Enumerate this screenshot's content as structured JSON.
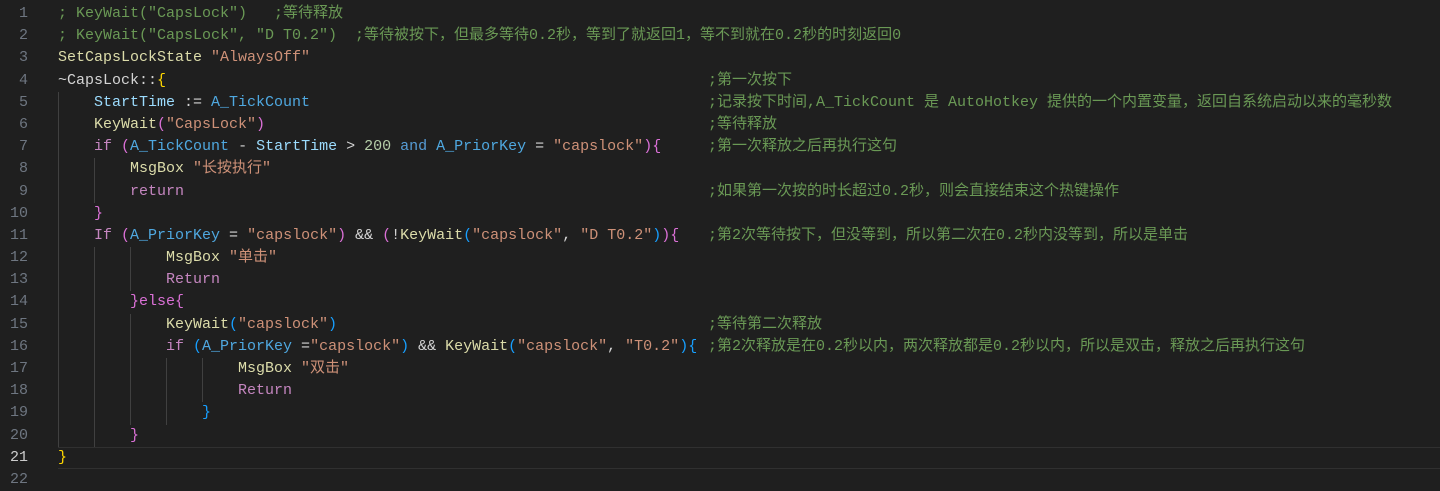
{
  "editor": {
    "active_line": 21,
    "lines": [
      {
        "n": "1",
        "indent": 0,
        "tokens": [
          {
            "t": "; KeyWait(\"CapsLock\")   ;等待释放",
            "c": "comment"
          }
        ]
      },
      {
        "n": "2",
        "indent": 0,
        "tokens": [
          {
            "t": "; KeyWait(\"CapsLock\", \"D T0.2\")  ;等待被按下，但最多等待0.2秒，等到了就返回1，等不到就在0.2秒的时刻返回0",
            "c": "comment"
          }
        ]
      },
      {
        "n": "3",
        "indent": 0,
        "tokens": [
          {
            "t": "SetCapsLockState ",
            "c": "func"
          },
          {
            "t": "\"AlwaysOff\"",
            "c": "string"
          }
        ]
      },
      {
        "n": "4",
        "indent": 0,
        "tokens": [
          {
            "t": "~CapsLock::",
            "c": "plain"
          },
          {
            "t": "{",
            "c": "b1"
          }
        ],
        "comment": ";第一次按下"
      },
      {
        "n": "5",
        "indent": 4,
        "tokens": [
          {
            "t": "StartTime",
            "c": "var"
          },
          {
            "t": " := ",
            "c": "plain"
          },
          {
            "t": "A_TickCount",
            "c": "builtin"
          }
        ],
        "comment": ";记录按下时间,A_TickCount 是 AutoHotkey 提供的一个内置变量，返回自系统启动以来的毫秒数"
      },
      {
        "n": "6",
        "indent": 4,
        "tokens": [
          {
            "t": "KeyWait",
            "c": "func"
          },
          {
            "t": "(",
            "c": "b2"
          },
          {
            "t": "\"CapsLock\"",
            "c": "string"
          },
          {
            "t": ")",
            "c": "b2"
          }
        ],
        "comment": ";等待释放"
      },
      {
        "n": "7",
        "indent": 4,
        "tokens": [
          {
            "t": "if ",
            "c": "ctrl"
          },
          {
            "t": "(",
            "c": "b2"
          },
          {
            "t": "A_TickCount",
            "c": "builtin"
          },
          {
            "t": " - ",
            "c": "plain"
          },
          {
            "t": "StartTime",
            "c": "var"
          },
          {
            "t": " > ",
            "c": "plain"
          },
          {
            "t": "200",
            "c": "num"
          },
          {
            "t": " and ",
            "c": "kw"
          },
          {
            "t": "A_PriorKey",
            "c": "builtin"
          },
          {
            "t": " = ",
            "c": "plain"
          },
          {
            "t": "\"capslock\"",
            "c": "string"
          },
          {
            "t": "){",
            "c": "b2"
          }
        ],
        "comment": ";第一次释放之后再执行这句"
      },
      {
        "n": "8",
        "indent": 8,
        "tokens": [
          {
            "t": "MsgBox ",
            "c": "func"
          },
          {
            "t": "\"长按执行\"",
            "c": "string"
          }
        ]
      },
      {
        "n": "9",
        "indent": 8,
        "tokens": [
          {
            "t": "return",
            "c": "ctrl"
          }
        ],
        "comment": ";如果第一次按的时长超过0.2秒，则会直接结束这个热键操作"
      },
      {
        "n": "10",
        "indent": 4,
        "tokens": [
          {
            "t": "}",
            "c": "b2"
          }
        ]
      },
      {
        "n": "11",
        "indent": 4,
        "tokens": [
          {
            "t": "If ",
            "c": "ctrl"
          },
          {
            "t": "(",
            "c": "b2"
          },
          {
            "t": "A_PriorKey",
            "c": "builtin"
          },
          {
            "t": " = ",
            "c": "plain"
          },
          {
            "t": "\"capslock\"",
            "c": "string"
          },
          {
            "t": ")",
            "c": "b2"
          },
          {
            "t": " && ",
            "c": "plain"
          },
          {
            "t": "(",
            "c": "b2"
          },
          {
            "t": "!",
            "c": "plain"
          },
          {
            "t": "KeyWait",
            "c": "func"
          },
          {
            "t": "(",
            "c": "b3"
          },
          {
            "t": "\"capslock\"",
            "c": "string"
          },
          {
            "t": ", ",
            "c": "plain"
          },
          {
            "t": "\"D T0.2\"",
            "c": "string"
          },
          {
            "t": ")",
            "c": "b3"
          },
          {
            "t": ")",
            "c": "b2"
          },
          {
            "t": "{",
            "c": "b2"
          }
        ],
        "comment": ";第2次等待按下，但没等到，所以第二次在0.2秒内没等到，所以是单击"
      },
      {
        "n": "12",
        "indent": 12,
        "tokens": [
          {
            "t": "MsgBox ",
            "c": "func"
          },
          {
            "t": "\"单击\"",
            "c": "string"
          }
        ]
      },
      {
        "n": "13",
        "indent": 12,
        "tokens": [
          {
            "t": "Return",
            "c": "ctrl"
          }
        ]
      },
      {
        "n": "14",
        "indent": 8,
        "tokens": [
          {
            "t": "}else{",
            "c": "b2"
          }
        ]
      },
      {
        "n": "15",
        "indent": 12,
        "tokens": [
          {
            "t": "KeyWait",
            "c": "func"
          },
          {
            "t": "(",
            "c": "b3"
          },
          {
            "t": "\"capslock\"",
            "c": "string"
          },
          {
            "t": ")",
            "c": "b3"
          }
        ],
        "comment": ";等待第二次释放"
      },
      {
        "n": "16",
        "indent": 12,
        "tokens": [
          {
            "t": "if ",
            "c": "ctrl"
          },
          {
            "t": "(",
            "c": "b3"
          },
          {
            "t": "A_PriorKey",
            "c": "builtin"
          },
          {
            "t": " =",
            "c": "plain"
          },
          {
            "t": "\"capslock\"",
            "c": "string"
          },
          {
            "t": ")",
            "c": "b3"
          },
          {
            "t": " && ",
            "c": "plain"
          },
          {
            "t": "KeyWait",
            "c": "func"
          },
          {
            "t": "(",
            "c": "b3"
          },
          {
            "t": "\"capslock\"",
            "c": "string"
          },
          {
            "t": ", ",
            "c": "plain"
          },
          {
            "t": "\"T0.2\"",
            "c": "string"
          },
          {
            "t": "){",
            "c": "b3"
          }
        ],
        "comment": ";第2次释放是在0.2秒以内，两次释放都是0.2秒以内，所以是双击，释放之后再执行这句"
      },
      {
        "n": "17",
        "indent": 20,
        "tokens": [
          {
            "t": "MsgBox ",
            "c": "func"
          },
          {
            "t": "\"双击\"",
            "c": "string"
          }
        ]
      },
      {
        "n": "18",
        "indent": 20,
        "tokens": [
          {
            "t": "Return",
            "c": "ctrl"
          }
        ]
      },
      {
        "n": "19",
        "indent": 16,
        "tokens": [
          {
            "t": "}",
            "c": "b3"
          }
        ]
      },
      {
        "n": "20",
        "indent": 8,
        "tokens": [
          {
            "t": "}",
            "c": "b2"
          }
        ]
      },
      {
        "n": "21",
        "indent": 0,
        "tokens": [
          {
            "t": "}",
            "c": "b1"
          }
        ]
      },
      {
        "n": "22",
        "indent": 0,
        "tokens": []
      }
    ]
  }
}
